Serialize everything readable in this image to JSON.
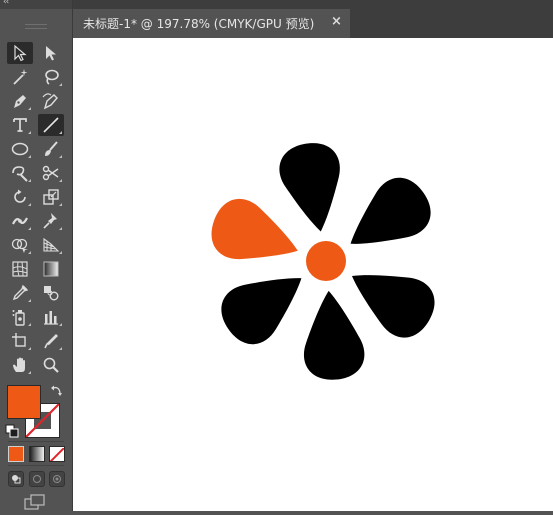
{
  "document_tab": {
    "title": "未标题-1* @ 197.78% (CMYK/GPU 预览)",
    "close_glyph": "×"
  },
  "toolbar": {
    "collapse_glyph": "‹‹",
    "tools": [
      "selection-tool",
      "direct-selection-tool",
      "magic-wand-tool",
      "lasso-tool",
      "pen-tool",
      "curvature-tool",
      "type-tool",
      "line-segment-tool",
      "ellipse-tool",
      "paintbrush-tool",
      "shaper-tool",
      "scissors-tool",
      "rotate-tool",
      "scale-tool",
      "width-tool",
      "puppet-warp-tool",
      "shape-builder-tool",
      "perspective-grid-tool",
      "mesh-tool",
      "gradient-tool",
      "eyedropper-tool",
      "blend-tool",
      "symbol-sprayer-tool",
      "column-graph-tool",
      "artboard-tool",
      "slice-tool",
      "hand-tool",
      "zoom-tool"
    ],
    "active_tools": [
      "selection-tool",
      "line-segment-tool"
    ],
    "fill_color": "#ee5a16",
    "stroke": "none"
  },
  "artwork": {
    "accent_color": "#ee5a16",
    "petal_color": "#000000",
    "petal_count": 6,
    "orange_petal_index": 0
  }
}
